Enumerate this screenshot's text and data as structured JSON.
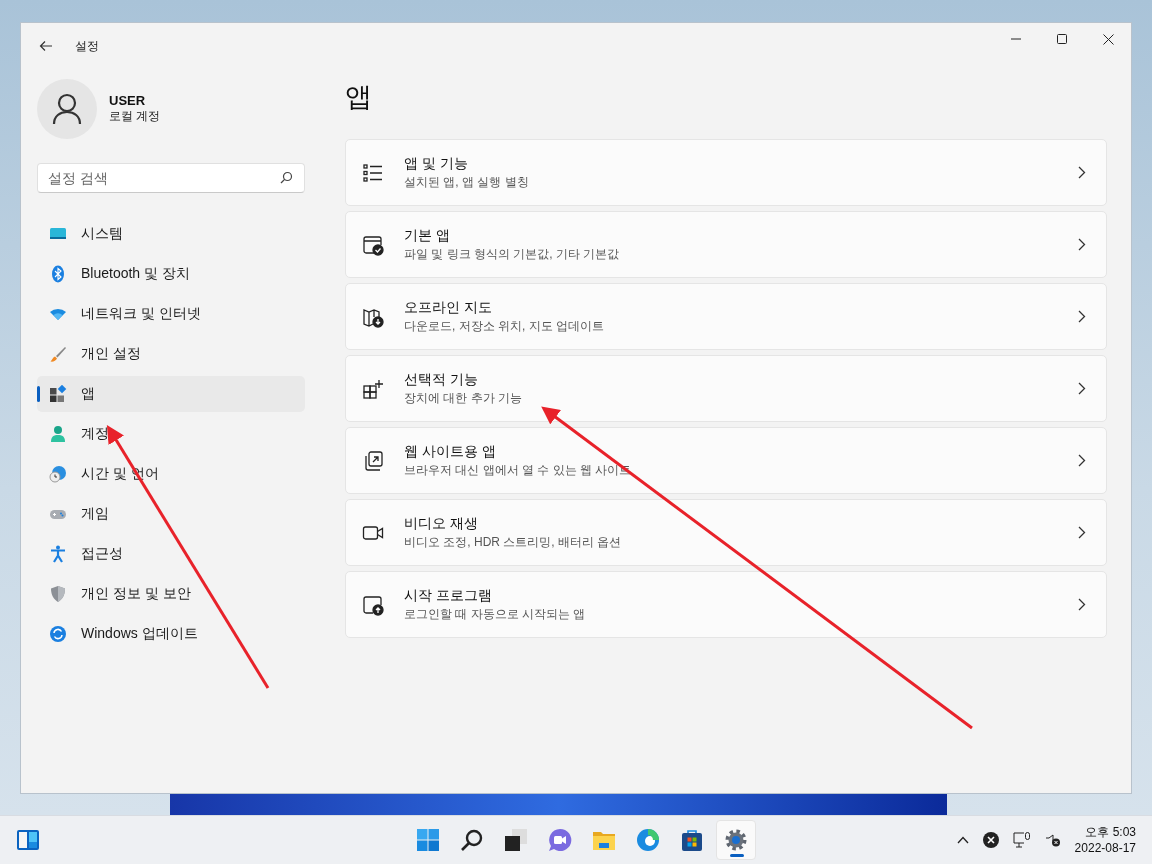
{
  "window": {
    "title": "설정"
  },
  "profile": {
    "name": "USER",
    "account": "로컬 계정"
  },
  "search": {
    "placeholder": "설정 검색"
  },
  "nav": [
    {
      "label": "시스템",
      "selected": false
    },
    {
      "label": "Bluetooth 및 장치",
      "selected": false
    },
    {
      "label": "네트워크 및 인터넷",
      "selected": false
    },
    {
      "label": "개인 설정",
      "selected": false
    },
    {
      "label": "앱",
      "selected": true
    },
    {
      "label": "계정",
      "selected": false
    },
    {
      "label": "시간 및 언어",
      "selected": false
    },
    {
      "label": "게임",
      "selected": false
    },
    {
      "label": "접근성",
      "selected": false
    },
    {
      "label": "개인 정보 및 보안",
      "selected": false
    },
    {
      "label": "Windows 업데이트",
      "selected": false
    }
  ],
  "page_title": "앱",
  "cards": [
    {
      "title": "앱 및 기능",
      "subtitle": "설치된 앱, 앱 실행 별칭"
    },
    {
      "title": "기본 앱",
      "subtitle": "파일 및 링크 형식의 기본값, 기타 기본값"
    },
    {
      "title": "오프라인 지도",
      "subtitle": "다운로드, 저장소 위치, 지도 업데이트"
    },
    {
      "title": "선택적 기능",
      "subtitle": "장치에 대한 추가 기능"
    },
    {
      "title": "웹 사이트용 앱",
      "subtitle": "브라우저 대신 앱에서 열 수 있는 웹 사이트"
    },
    {
      "title": "비디오 재생",
      "subtitle": "비디오 조정, HDR 스트리밍, 배터리 옵션"
    },
    {
      "title": "시작 프로그램",
      "subtitle": "로그인할 때 자동으로 시작되는 앱"
    }
  ],
  "taskbar": {
    "apps": [
      {
        "selected": false
      },
      {
        "selected": false
      },
      {
        "selected": false
      },
      {
        "selected": false
      },
      {
        "selected": false
      },
      {
        "selected": false
      },
      {
        "selected": false
      },
      {
        "selected": true
      }
    ],
    "clock": {
      "time": "오후 5:03",
      "date": "2022-08-17"
    }
  }
}
